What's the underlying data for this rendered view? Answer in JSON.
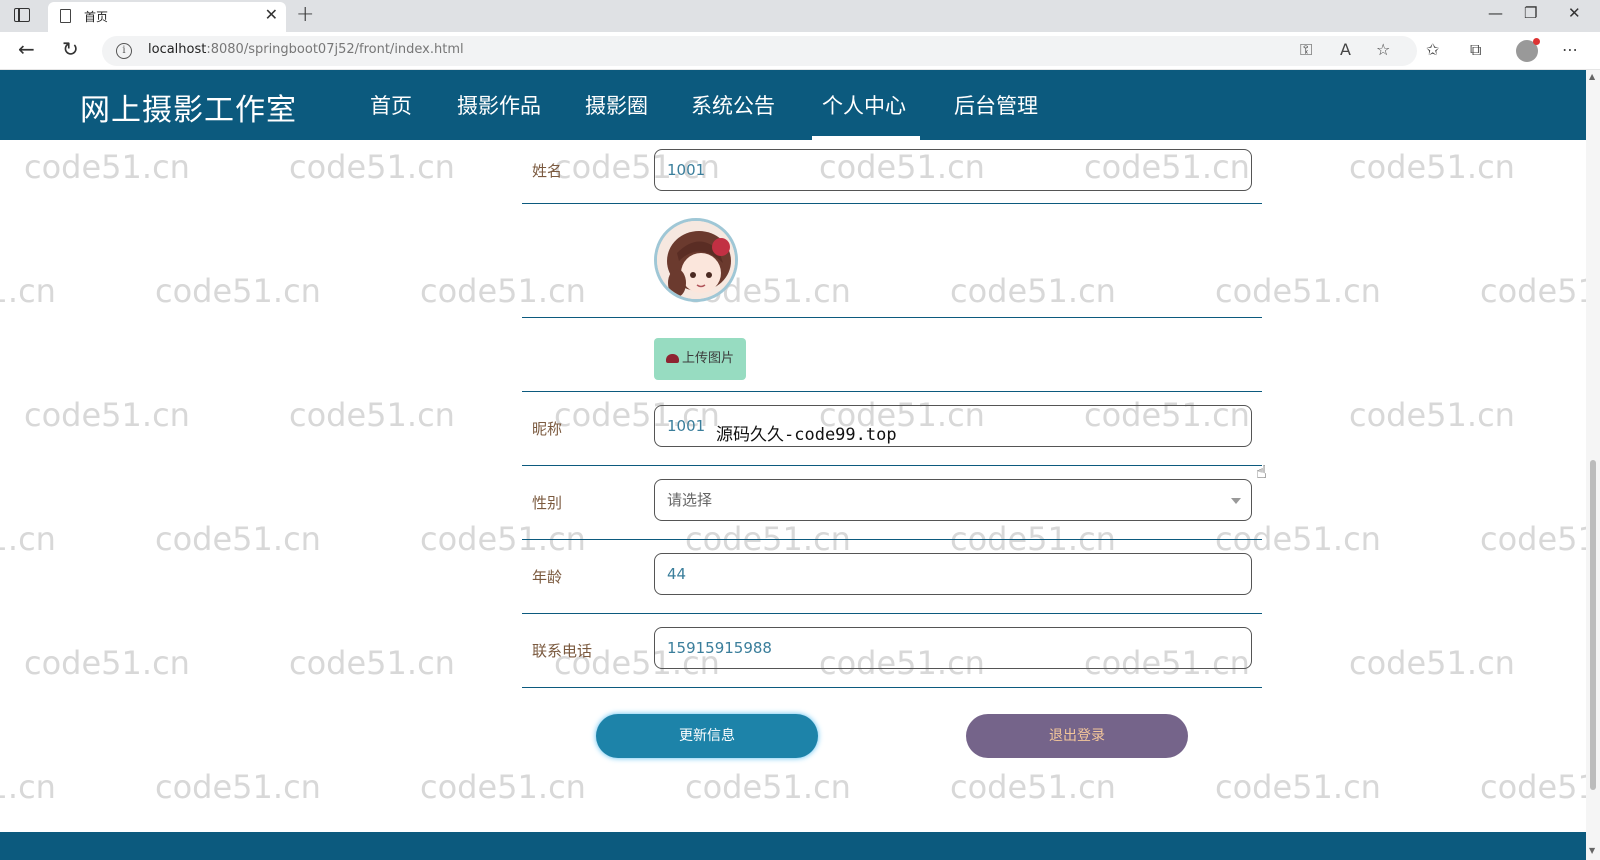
{
  "browser": {
    "tab_title": "首页",
    "tab_close": "✕",
    "new_tab": "+",
    "url_host": "localhost",
    "url_path": ":8080/springboot07j52/front/index.html",
    "back": "←",
    "refresh": "↻",
    "minimize": "—",
    "restore": "❐",
    "close": "✕"
  },
  "header": {
    "site_title": "网上摄影工作室",
    "nav": [
      "首页",
      "摄影作品",
      "摄影圈",
      "系统公告",
      "个人中心",
      "后台管理"
    ],
    "active_nav": "个人中心"
  },
  "watermark_text": "code51.cn",
  "form": {
    "name_label": "姓名",
    "name_value": "1001",
    "upload_label": "上传图片",
    "nickname_label": "昵称",
    "nickname_value": "1001",
    "gender_label": "性别",
    "gender_placeholder": "请选择",
    "age_label": "年龄",
    "age_value": "44",
    "phone_label": "联系电话",
    "phone_value": "15915915988"
  },
  "overlay_text": "源码久久-code99.top",
  "buttons": {
    "update": "更新信息",
    "logout": "退出登录"
  },
  "colors": {
    "header": "#0c5a7e",
    "update_button": "#1d83a9",
    "logout_button": "#75648a",
    "upload_button": "#97dcc1"
  }
}
